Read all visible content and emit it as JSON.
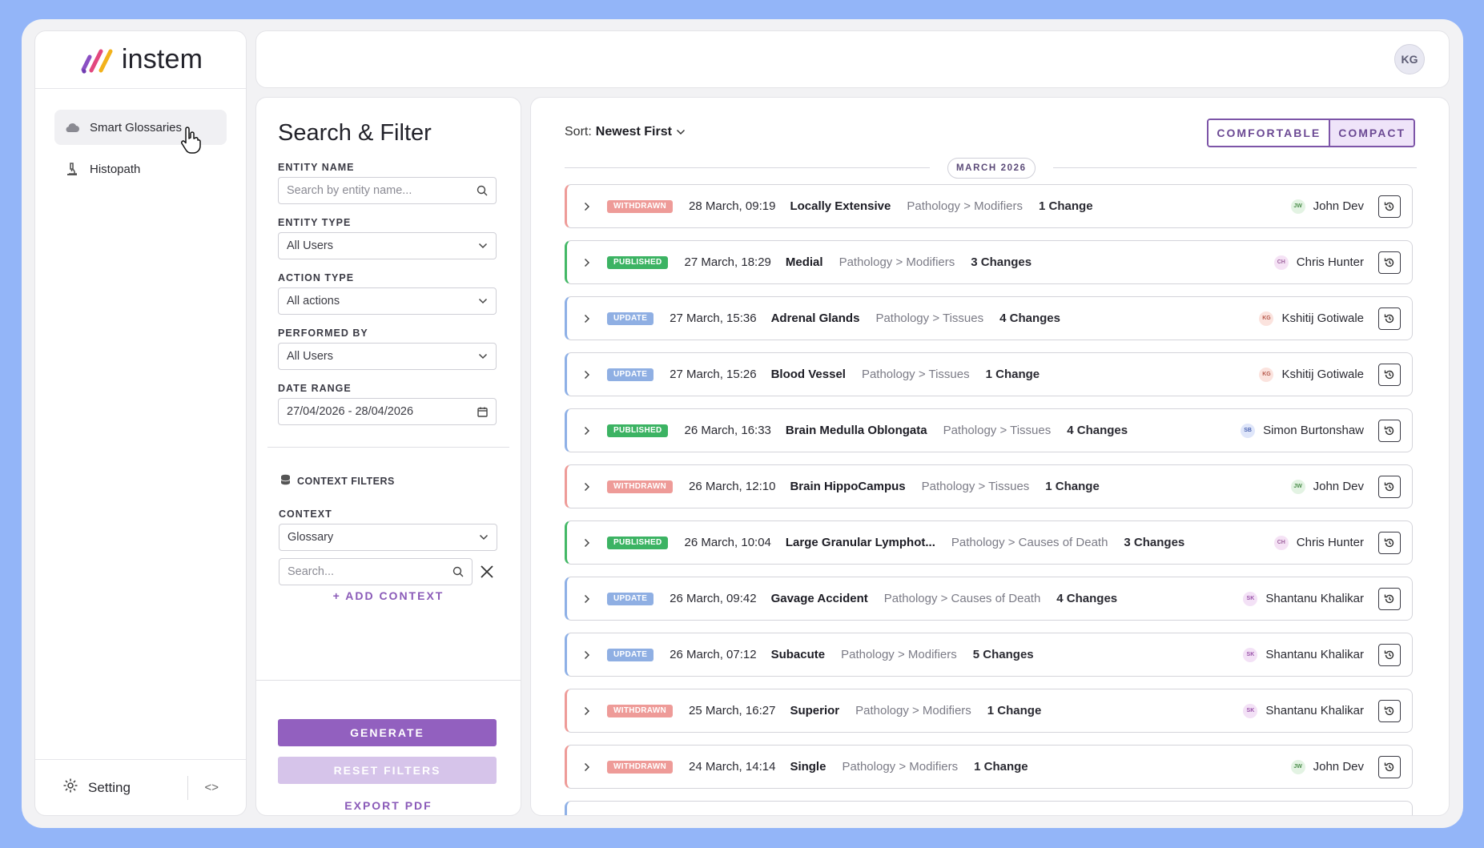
{
  "brand": {
    "name": "instem"
  },
  "sidebar": {
    "items": [
      {
        "label": "Smart Glossaries",
        "icon": "cloud-icon"
      },
      {
        "label": "Histopath",
        "icon": "microscope-icon"
      }
    ],
    "footer": {
      "setting_label": "Setting",
      "toggle_label": "<>"
    }
  },
  "header": {
    "user_initials": "KG"
  },
  "filter": {
    "title": "Search & Filter",
    "entity_name": {
      "label": "ENTITY NAME",
      "placeholder": "Search by entity name..."
    },
    "entity_type": {
      "label": "ENTITY TYPE",
      "value": "All Users"
    },
    "action_type": {
      "label": "ACTION TYPE",
      "value": "All actions"
    },
    "performed_by": {
      "label": "PERFORMED BY",
      "value": "All Users"
    },
    "date_range": {
      "label": "DATE RANGE",
      "value": "27/04/2026 - 28/04/2026"
    },
    "context_filters_label": "CONTEXT FILTERS",
    "context": {
      "label": "CONTEXT",
      "value": "Glossary",
      "search_placeholder": "Search..."
    },
    "add_context": "+ ADD CONTEXT",
    "generate": "GENERATE",
    "reset": "RESET FILTERS",
    "export": "EXPORT PDF"
  },
  "main": {
    "sort_prefix": "Sort:",
    "sort_value": "Newest First",
    "view_options": [
      "COMFORTABLE",
      "COMPACT"
    ],
    "active_view": "COMPACT",
    "month": "MARCH 2026",
    "rows": [
      {
        "status": "withdrawn",
        "badge": "WITHDRAWN",
        "date": "28 March, 09:19",
        "name": "Locally Extensive",
        "path": "Pathology > Modifiers",
        "changes": "1 Change",
        "initials": "JW",
        "user": "John Dev"
      },
      {
        "status": "published",
        "badge": "PUBLISHED",
        "date": "27 March, 18:29",
        "name": "Medial",
        "path": "Pathology > Modifiers",
        "changes": "3 Changes",
        "initials": "CH",
        "user": "Chris Hunter"
      },
      {
        "status": "update",
        "badge": "UPDATE",
        "date": "27 March, 15:36",
        "name": "Adrenal Glands",
        "path": "Pathology > Tissues",
        "changes": "4 Changes",
        "initials": "KG",
        "user": "Kshitij Gotiwale"
      },
      {
        "status": "update",
        "badge": "UPDATE",
        "date": "27 March, 15:26",
        "name": "Blood Vessel",
        "path": "Pathology > Tissues",
        "changes": "1 Change",
        "initials": "KG",
        "user": "Kshitij Gotiwale"
      },
      {
        "status": "update",
        "badge": "PUBLISHED",
        "date": "26 March, 16:33",
        "name": "Brain Medulla Oblongata",
        "path": "Pathology > Tissues",
        "changes": "4 Changes",
        "initials": "SB",
        "user": "Simon Burtonshaw"
      },
      {
        "status": "withdrawn",
        "badge": "WITHDRAWN",
        "date": "26 March, 12:10",
        "name": "Brain HippoCampus",
        "path": "Pathology > Tissues",
        "changes": "1 Change",
        "initials": "JW",
        "user": "John Dev"
      },
      {
        "status": "published",
        "badge": "PUBLISHED",
        "date": "26 March, 10:04",
        "name": "Large Granular Lymphot...",
        "path": "Pathology > Causes of Death",
        "changes": "3 Changes",
        "initials": "CH",
        "user": "Chris Hunter"
      },
      {
        "status": "update",
        "badge": "UPDATE",
        "date": "26 March, 09:42",
        "name": "Gavage Accident",
        "path": "Pathology > Causes of Death",
        "changes": "4 Changes",
        "initials": "SK",
        "user": "Shantanu Khalikar"
      },
      {
        "status": "update",
        "badge": "UPDATE",
        "date": "26 March, 07:12",
        "name": "Subacute",
        "path": "Pathology > Modifiers",
        "changes": "5 Changes",
        "initials": "SK",
        "user": "Shantanu Khalikar"
      },
      {
        "status": "withdrawn",
        "badge": "WITHDRAWN",
        "date": "25 March, 16:27",
        "name": "Superior",
        "path": "Pathology > Modifiers",
        "changes": "1 Change",
        "initials": "SK",
        "user": "Shantanu Khalikar"
      },
      {
        "status": "withdrawn",
        "badge": "WITHDRAWN",
        "date": "24 March, 14:14",
        "name": "Single",
        "path": "Pathology > Modifiers",
        "changes": "1 Change",
        "initials": "JW",
        "user": "John Dev"
      }
    ]
  },
  "colors": {
    "accent": "#9260bf",
    "withdrawn": "#ee9b98",
    "published": "#3cb363",
    "update": "#8fafe3",
    "background": "#93b5f8"
  }
}
